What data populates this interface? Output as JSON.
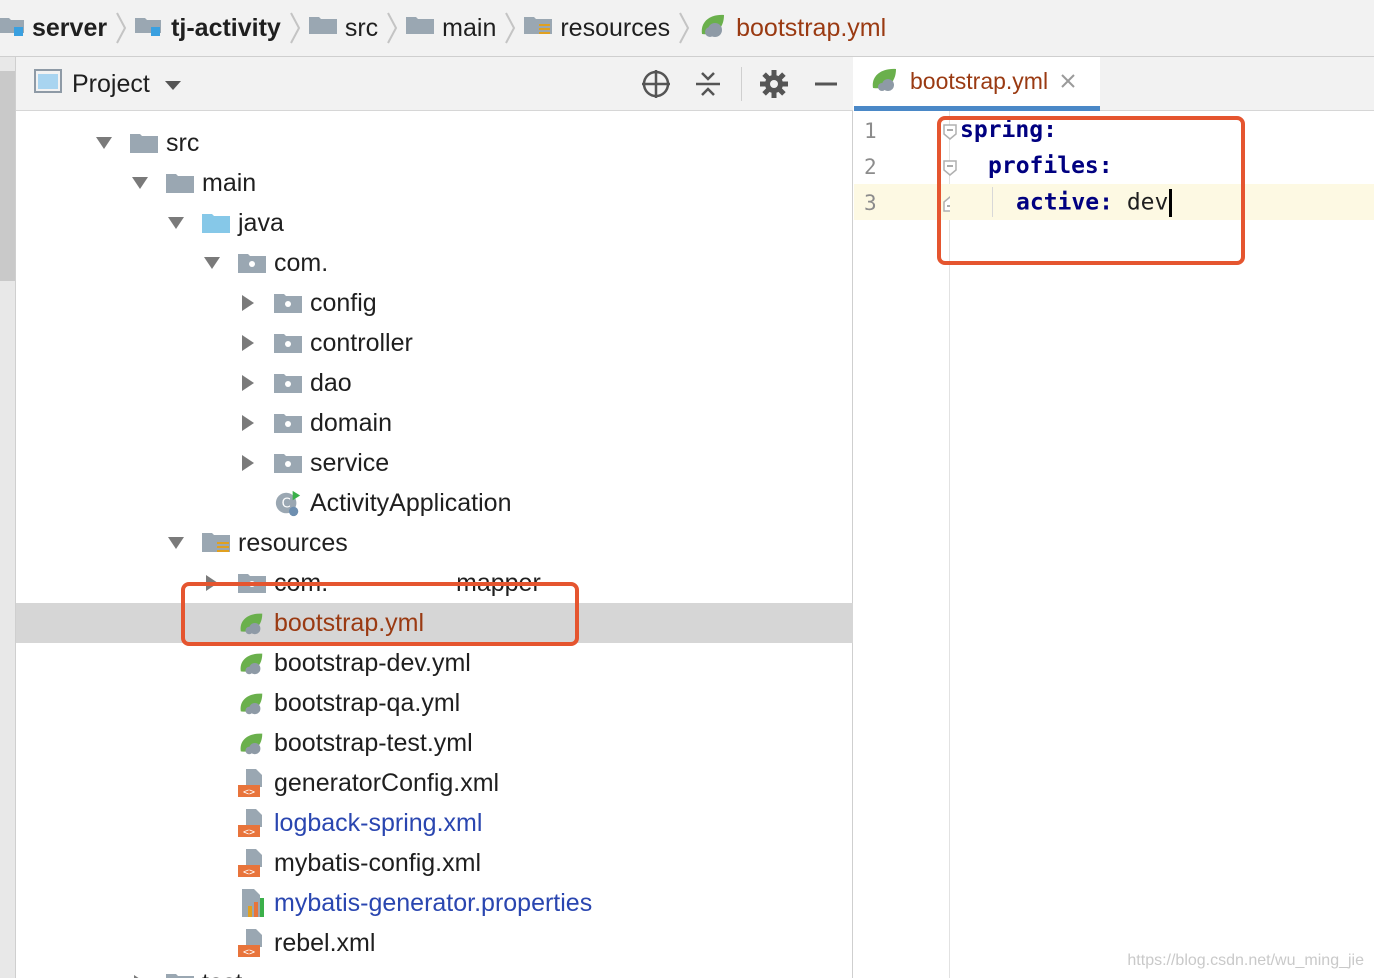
{
  "breadcrumb": {
    "items": [
      {
        "label": "server",
        "icon": "module-folder-icon"
      },
      {
        "label": "tj-activity",
        "icon": "module-folder-icon"
      },
      {
        "label": "src",
        "icon": "folder-icon"
      },
      {
        "label": "main",
        "icon": "folder-icon"
      },
      {
        "label": "resources",
        "icon": "resources-folder-icon"
      },
      {
        "label": "bootstrap.yml",
        "icon": "spring-yml-icon"
      }
    ]
  },
  "project": {
    "title": "Project",
    "tree": [
      {
        "label": "src",
        "icon": "folder"
      },
      {
        "label": "main",
        "icon": "folder"
      },
      {
        "label": "java",
        "icon": "source-folder"
      },
      {
        "label": "com.",
        "icon": "package"
      },
      {
        "label": "config",
        "icon": "package"
      },
      {
        "label": "controller",
        "icon": "package"
      },
      {
        "label": "dao",
        "icon": "package"
      },
      {
        "label": "domain",
        "icon": "package"
      },
      {
        "label": "service",
        "icon": "package"
      },
      {
        "label": "ActivityApplication",
        "icon": "spring-boot-class"
      },
      {
        "label": "resources",
        "icon": "resources-folder"
      },
      {
        "label": "com.",
        "icon": "package"
      },
      {
        "label": "bootstrap.yml",
        "icon": "spring-yml"
      },
      {
        "label": "bootstrap-dev.yml",
        "icon": "spring-yml"
      },
      {
        "label": "bootstrap-qa.yml",
        "icon": "spring-yml"
      },
      {
        "label": "bootstrap-test.yml",
        "icon": "spring-yml"
      },
      {
        "label": "generatorConfig.xml",
        "icon": "xml-file"
      },
      {
        "label": "logback-spring.xml",
        "icon": "xml-file"
      },
      {
        "label": "mybatis-config.xml",
        "icon": "xml-file"
      },
      {
        "label": "mybatis-generator.properties",
        "icon": "properties-file"
      },
      {
        "label": "rebel.xml",
        "icon": "xml-file"
      },
      {
        "label": "test",
        "icon": "folder"
      }
    ],
    "mapper_label": "mapper"
  },
  "editor": {
    "tab_label": "bootstrap.yml",
    "lines": [
      {
        "number": "1",
        "key": "spring",
        "value": ""
      },
      {
        "number": "2",
        "key": "profiles",
        "value": ""
      },
      {
        "number": "3",
        "key": "active",
        "value": "dev"
      }
    ]
  },
  "watermark": "https://blog.csdn.net/wu_ming_jie",
  "colors": {
    "highlight": "#e5552f",
    "selected_row": "#d6d6d6",
    "link_blue": "#2a46b0",
    "file_red": "#9a3a12",
    "yaml_key": "#000080"
  }
}
